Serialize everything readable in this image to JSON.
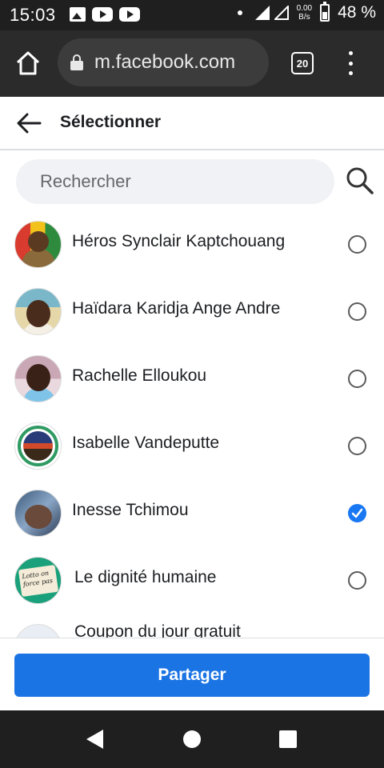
{
  "status_bar": {
    "time": "15:03",
    "speed_value": "0.00",
    "speed_unit": "B/s",
    "battery": "48 %"
  },
  "browser": {
    "url": "m.facebook.com",
    "tab_count": "20"
  },
  "header": {
    "title": "Sélectionner"
  },
  "search": {
    "placeholder": "Rechercher"
  },
  "contacts": [
    {
      "name": "Héros Synclair Kaptchouang",
      "selected": false
    },
    {
      "name": "Haïdara Karidja Ange Andre",
      "selected": false
    },
    {
      "name": "Rachelle Elloukou",
      "selected": false
    },
    {
      "name": "Isabelle Vandeputte",
      "selected": false
    },
    {
      "name": "Inesse Tchimou",
      "selected": true
    },
    {
      "name": "Le dignité humaine",
      "selected": false,
      "avatar_text": "Lotto on force pas"
    },
    {
      "name": "Coupon du jour gratuit",
      "selected": false
    }
  ],
  "share_button": {
    "label": "Partager"
  },
  "colors": {
    "accent": "#1b74e4",
    "status_bar": "#1f1f1f",
    "browser_bar": "#2b2b2b",
    "search_bg": "#f0f2f5"
  }
}
